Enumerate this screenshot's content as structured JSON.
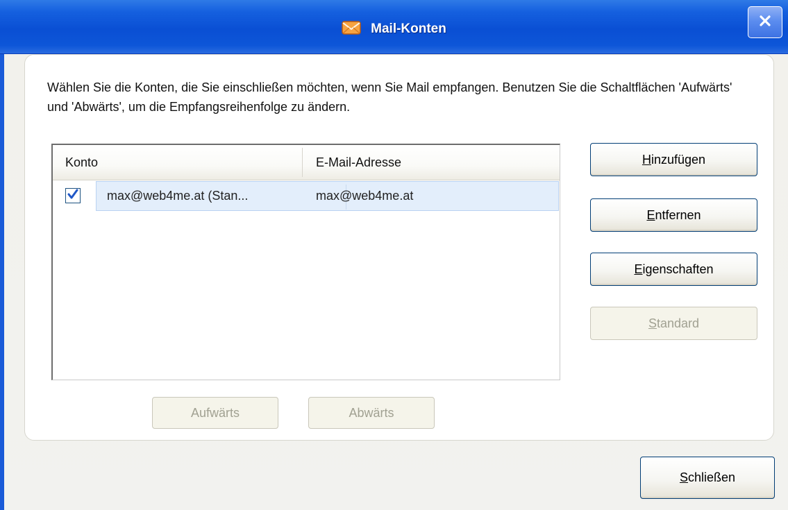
{
  "window": {
    "title": "Mail-Konten",
    "close_glyph": "×",
    "title_icon": "envelope-icon",
    "title_bar_color": "#0a4fd4",
    "accent_color": "#003c74"
  },
  "instruction": "Wählen Sie die Konten, die Sie einschließen möchten, wenn Sie Mail empfangen. Benutzen Sie die Schaltflächen 'Aufwärts' und 'Abwärts', um die Empfangsreihenfolge zu ändern.",
  "accounts_table": {
    "columns": [
      "Konto",
      "E-Mail-Adresse"
    ],
    "rows": [
      {
        "checked": true,
        "account": "max@web4me.at (Stan...",
        "email": "max@web4me.at"
      }
    ]
  },
  "buttons": {
    "add": {
      "mnemonic": "H",
      "rest": "inzufügen"
    },
    "remove": {
      "mnemonic": "E",
      "rest": "ntfernen"
    },
    "properties": {
      "mnemonic": "E",
      "rest": "igenschaften"
    },
    "standard": {
      "mnemonic": "S",
      "rest": "tandard",
      "disabled": true
    },
    "up": {
      "label": "Aufwärts",
      "disabled": true
    },
    "down": {
      "label": "Abwärts",
      "disabled": true
    },
    "close": {
      "mnemonic": "S",
      "rest": "chließen"
    }
  }
}
